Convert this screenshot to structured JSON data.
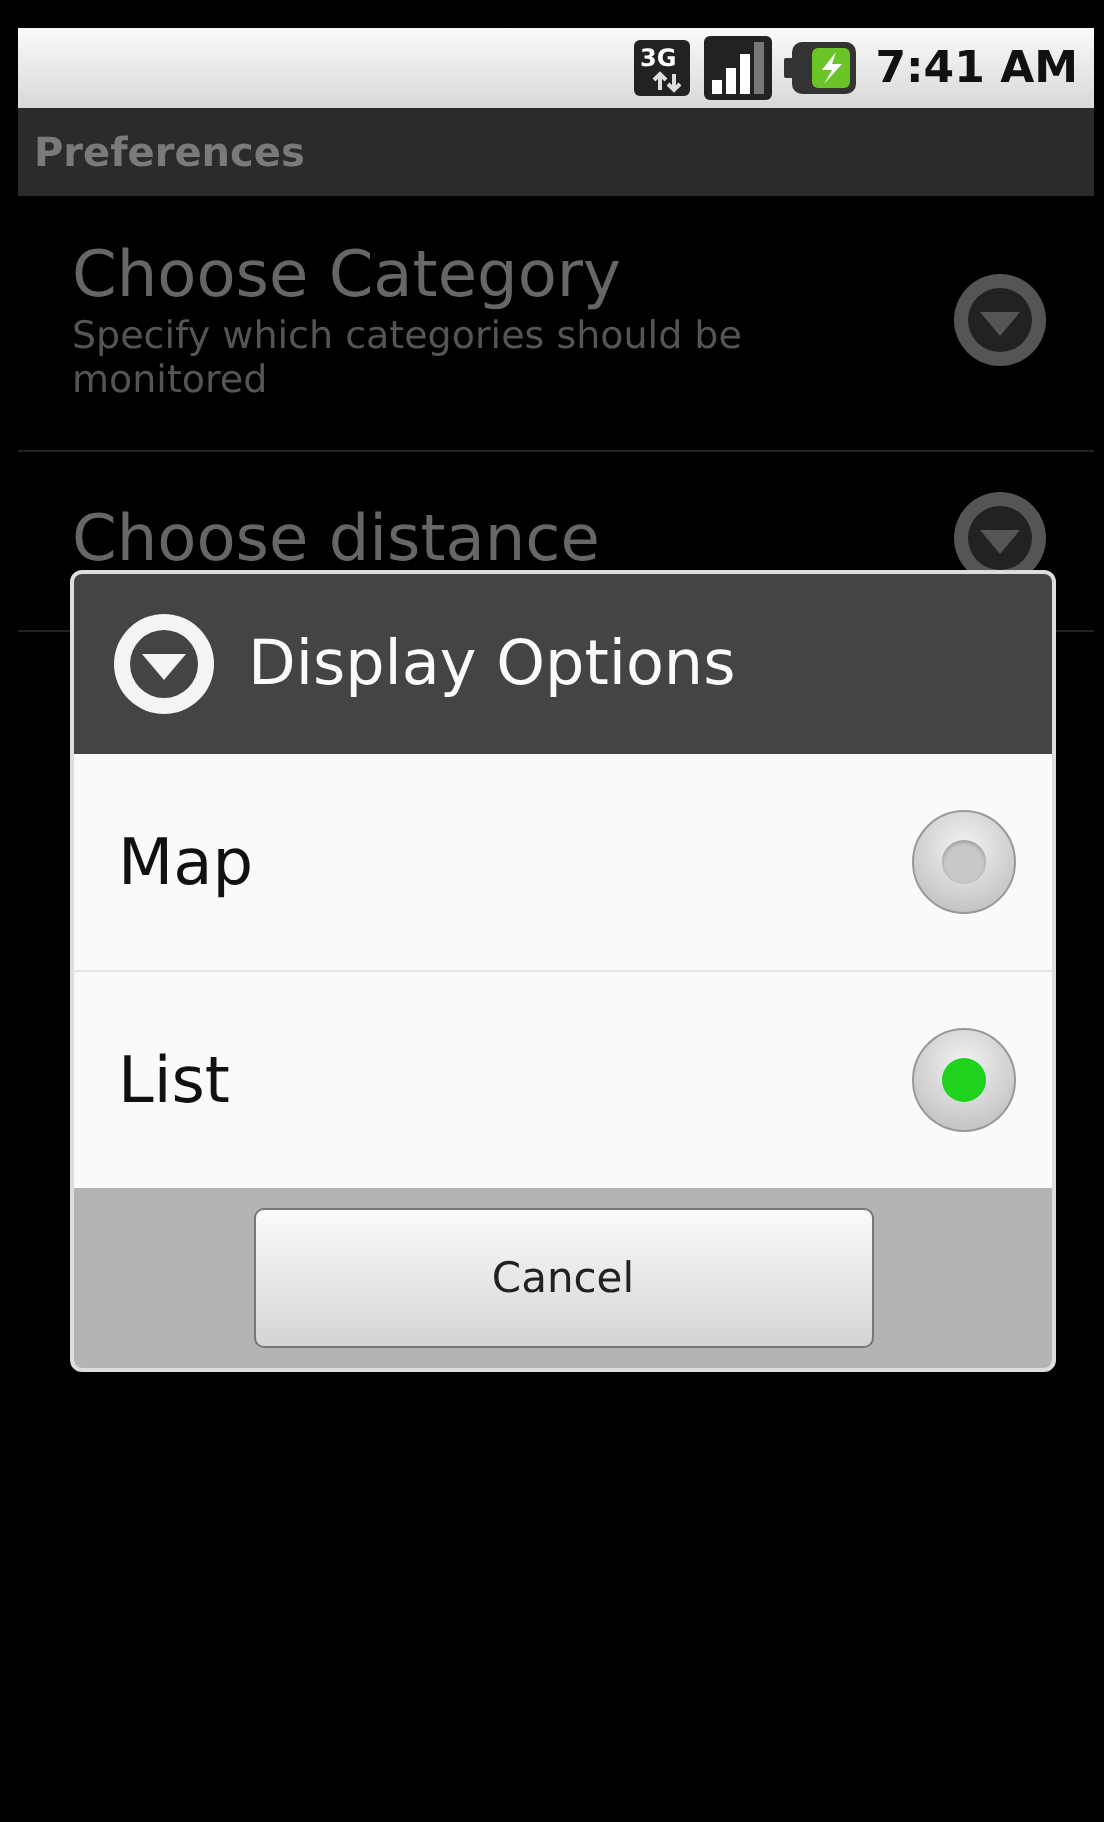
{
  "status_bar": {
    "network": "3G",
    "time": "7:41 AM"
  },
  "title_bar": {
    "title": "Preferences"
  },
  "preferences": [
    {
      "title": "Choose Category",
      "summary": "Specify which categories should be monitored"
    },
    {
      "title": "Choose distance"
    }
  ],
  "dialog": {
    "title": "Display Options",
    "options": [
      {
        "label": "Map",
        "selected": false
      },
      {
        "label": "List",
        "selected": true
      }
    ],
    "buttons": [
      "Cancel"
    ]
  }
}
